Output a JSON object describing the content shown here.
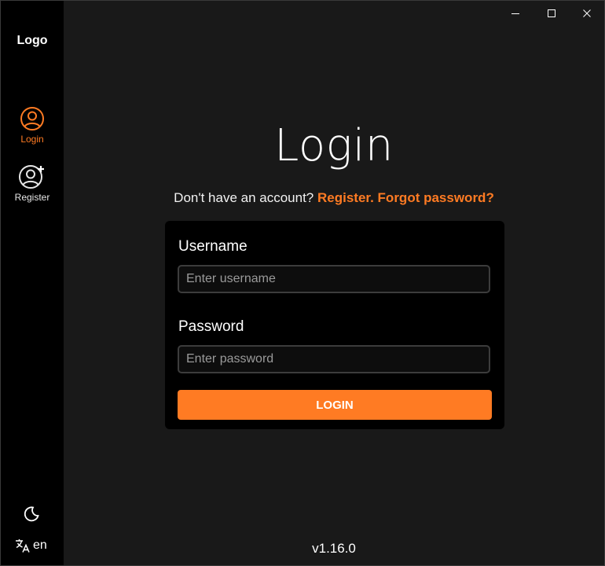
{
  "sidebar": {
    "logo": "Logo",
    "items": [
      {
        "label": "Login",
        "icon": "user-circle-icon",
        "active": true
      },
      {
        "label": "Register",
        "icon": "user-add-icon",
        "active": false
      }
    ],
    "theme_icon": "moon-icon",
    "language": {
      "icon": "translate-icon",
      "code": "en"
    }
  },
  "window_controls": {
    "minimize": "minimize-icon",
    "maximize": "maximize-icon",
    "close": "close-icon"
  },
  "main": {
    "title": "Login",
    "prompt": "Don't have an account?",
    "register_link": "Register.",
    "forgot_link": "Forgot password?",
    "form": {
      "username_label": "Username",
      "username_placeholder": "Enter username",
      "username_value": "",
      "password_label": "Password",
      "password_placeholder": "Enter password",
      "password_value": "",
      "submit_label": "LOGIN"
    },
    "version": "v1.16.0"
  },
  "colors": {
    "accent": "#ff7b23",
    "background": "#191919",
    "sidebar": "#000000",
    "card": "#000000"
  }
}
